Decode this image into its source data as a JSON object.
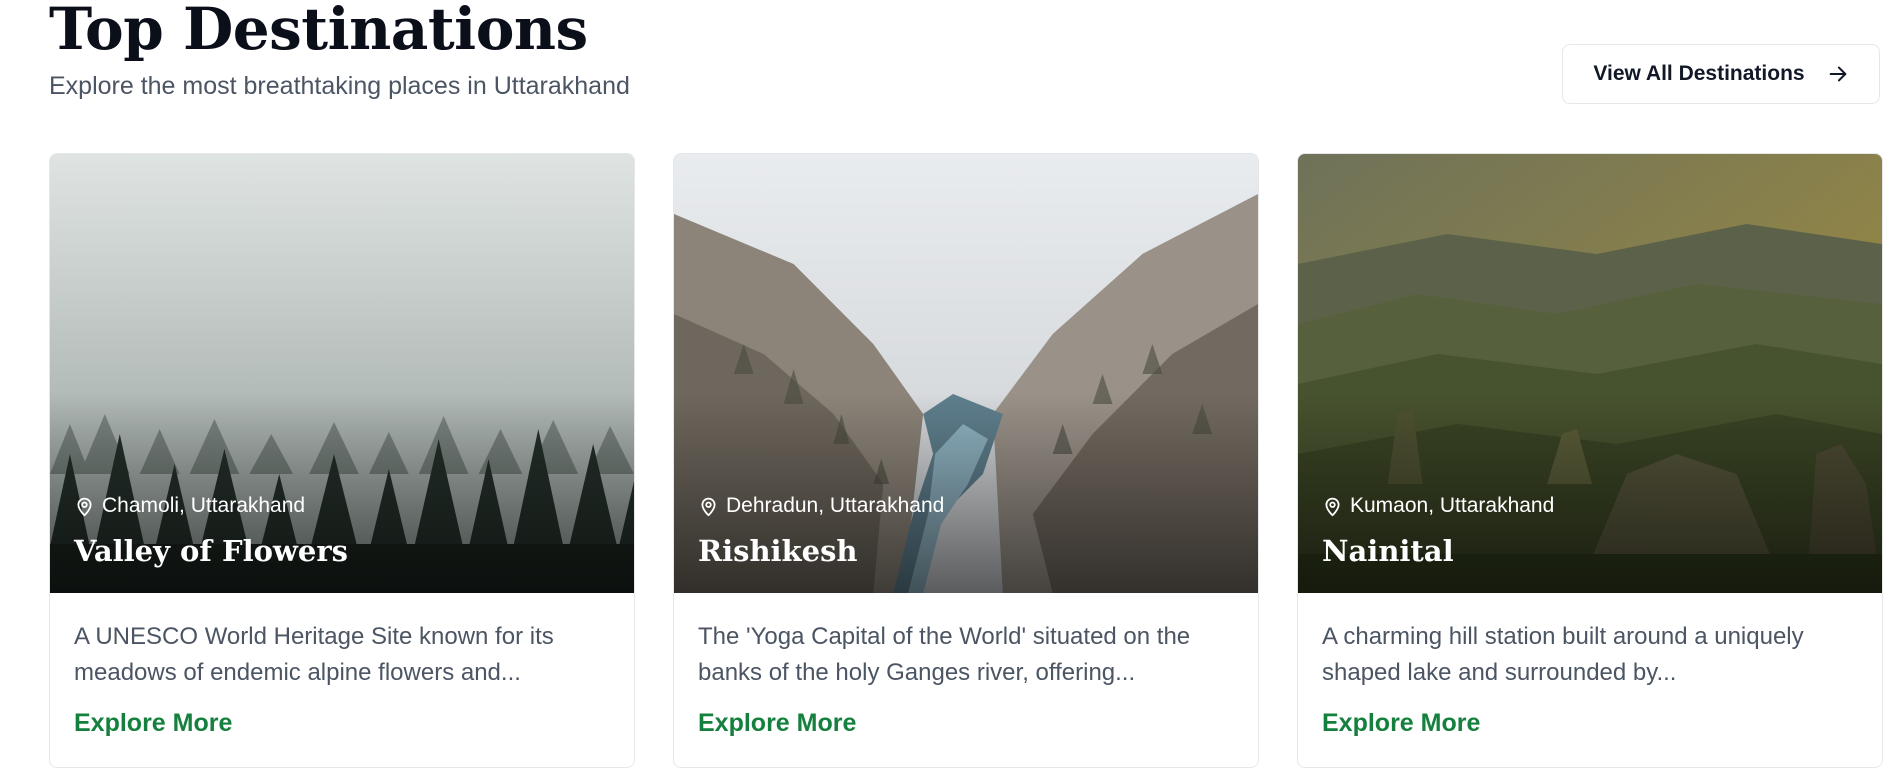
{
  "header": {
    "title": "Top Destinations",
    "subtitle": "Explore the most breathtaking places in Uttarakhand",
    "view_all_label": "View All Destinations"
  },
  "cards": [
    {
      "location": "Chamoli, Uttarakhand",
      "name": "Valley of Flowers",
      "description": "A UNESCO World Heritage Site known for its meadows of endemic alpine flowers and...",
      "link_label": "Explore More"
    },
    {
      "location": "Dehradun, Uttarakhand",
      "name": "Rishikesh",
      "description": "The 'Yoga Capital of the World' situated on the banks of the holy Ganges river, offering...",
      "link_label": "Explore More"
    },
    {
      "location": "Kumaon, Uttarakhand",
      "name": "Nainital",
      "description": "A charming hill station built around a uniquely shaped lake and surrounded by...",
      "link_label": "Explore More"
    }
  ],
  "icons": {
    "location": "map-pin-icon",
    "arrow": "arrow-right-icon"
  },
  "colors": {
    "link": "#15803d",
    "title": "#0b0f1a",
    "subtitle": "#4b5563"
  }
}
